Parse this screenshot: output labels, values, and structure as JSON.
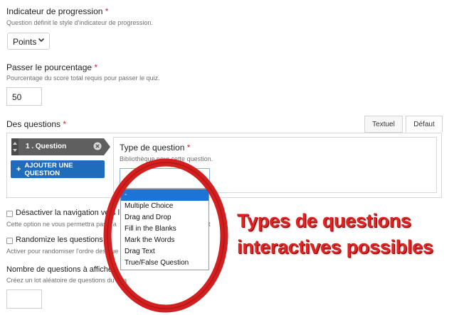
{
  "progress": {
    "label": "Indicateur de progression",
    "required": "*",
    "description": "Question définit le style d'indicateur de progression.",
    "select_value": "Points"
  },
  "pass": {
    "label": "Passer le pourcentage",
    "required": "*",
    "description": "Pourcentage du score total requis pour passer le quiz.",
    "value": "50"
  },
  "questions": {
    "label": "Des questions",
    "required": "*",
    "tabs": [
      "Textuel",
      "Défaut"
    ],
    "item_label": "1 . Question",
    "add_button": "AJOUTER UNE QUESTION",
    "type_label": "Type de question",
    "type_required": "*",
    "type_description": "Bibliothèque pour cette question.",
    "options": [
      "-",
      "Multiple Choice",
      "Drag and Drop",
      "Fill in the Blanks",
      "Mark the Words",
      "Drag Text",
      "True/False Question"
    ],
    "selected_index": 0
  },
  "disable_nav": {
    "label": "Désactiver la navigation vers l",
    "description": "Cette option ne vous permettra pas d'a",
    "description_tail": "t"
  },
  "randomize": {
    "label": "Randomize les questions",
    "description": "Activer pour randomiser l'ordre des que"
  },
  "count": {
    "label": "Nombre de questions à affiche",
    "description": "Créez un lot aléatoire de questions du tota"
  },
  "overlay": {
    "line1": "Types de questions",
    "line2": "interactives possibles",
    "accent_color": "#e02424"
  }
}
